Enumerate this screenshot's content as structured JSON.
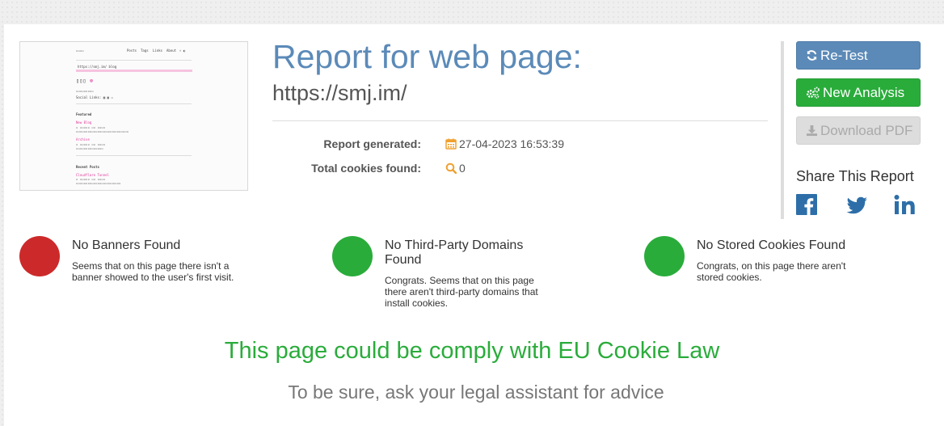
{
  "report": {
    "title": "Report for web page:",
    "url": "https://smj.im/",
    "generated_label": "Report generated:",
    "generated_value": "27-04-2023 16:53:39",
    "cookies_label": "Total cookies found:",
    "cookies_value": "0"
  },
  "actions": {
    "retest": "Re-Test",
    "new_analysis": "New Analysis",
    "download_pdf": "Download PDF"
  },
  "share": {
    "title": "Share This Report",
    "networks": [
      "facebook-icon",
      "twitter-icon",
      "linkedin-icon"
    ]
  },
  "stats": [
    {
      "title": "No Banners Found",
      "desc": "Seems that on this page there isn't a banner showed to the user's first visit.",
      "status": "red"
    },
    {
      "title": "No Third-Party Domains Found",
      "desc": "Congrats. Seems that on this page there aren't third-party domains that install cookies.",
      "status": "green"
    },
    {
      "title": "No Stored Cookies Found",
      "desc": "Congrats, on this page there aren't stored cookies.",
      "status": "green"
    }
  ],
  "verdict": "This page could be comply with EU Cookie Law",
  "advice": "To be sure, ask your legal assistant for advice",
  "colors": {
    "accent": "#5b8ab8",
    "success": "#2aac3b",
    "danger": "#cc2a2a",
    "calendar": "#f0a030"
  },
  "thumbnail": {
    "nav": [
      "Posts",
      "Tags",
      "Links",
      "About"
    ],
    "address": "https://smj.im/ blog",
    "featured": "Featured",
    "post1": "New Blog",
    "post2": "Archive",
    "recent": "Recent Posts",
    "post3": "Cloudflare Tunnel"
  }
}
